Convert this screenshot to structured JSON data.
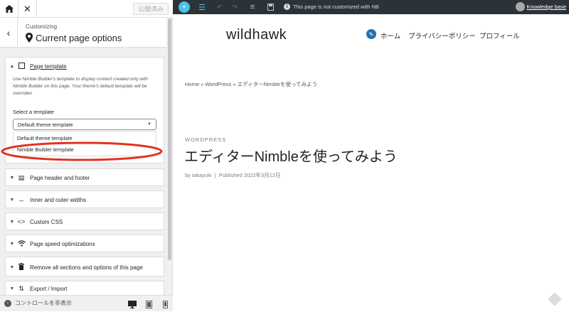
{
  "sidebar": {
    "publish_label": "公開済み",
    "crumb_small": "Customizing",
    "crumb_title": "Current page options",
    "page_template": {
      "title": "Page template",
      "description": "Use Nimble Builder's template to display content created only with Nimble Builder on this page. Your theme's default template will be overriden",
      "select_label": "Select a template",
      "selected": "Default theme template",
      "options": [
        "Default theme template",
        "Nimble Builder template"
      ]
    },
    "sections": [
      {
        "label": "Page header and footer",
        "icon": "header-footer-icon"
      },
      {
        "label": "Inner and outer widths",
        "icon": "widths-icon"
      },
      {
        "label": "Custom CSS",
        "icon": "code-icon"
      },
      {
        "label": "Page speed optimizations",
        "icon": "wifi-icon"
      },
      {
        "label": "Remove all sections and options of this page",
        "icon": "trash-icon"
      },
      {
        "label": "Export / Import",
        "icon": "export-import-icon"
      }
    ],
    "hide_controls_label": "コントロールを非表示"
  },
  "preview": {
    "notice": "This page is not customized with NB",
    "knowledge_base": "Knowledge base",
    "site_title": "wildhawk",
    "nav": [
      "ホーム",
      "プライバシーポリシー",
      "プロフィール"
    ],
    "breadcrumb": "Home » WordPress » エディターNimbleを使ってみよう",
    "category": "WORDPRESS",
    "post_title": "エディターNimbleを使ってみよう",
    "meta": "by takayuki  |  Published 2022年3月12日"
  },
  "colors": {
    "accent": "#2271b1",
    "highlight": "#e3321f",
    "nb_teal": "#48c1e8"
  }
}
